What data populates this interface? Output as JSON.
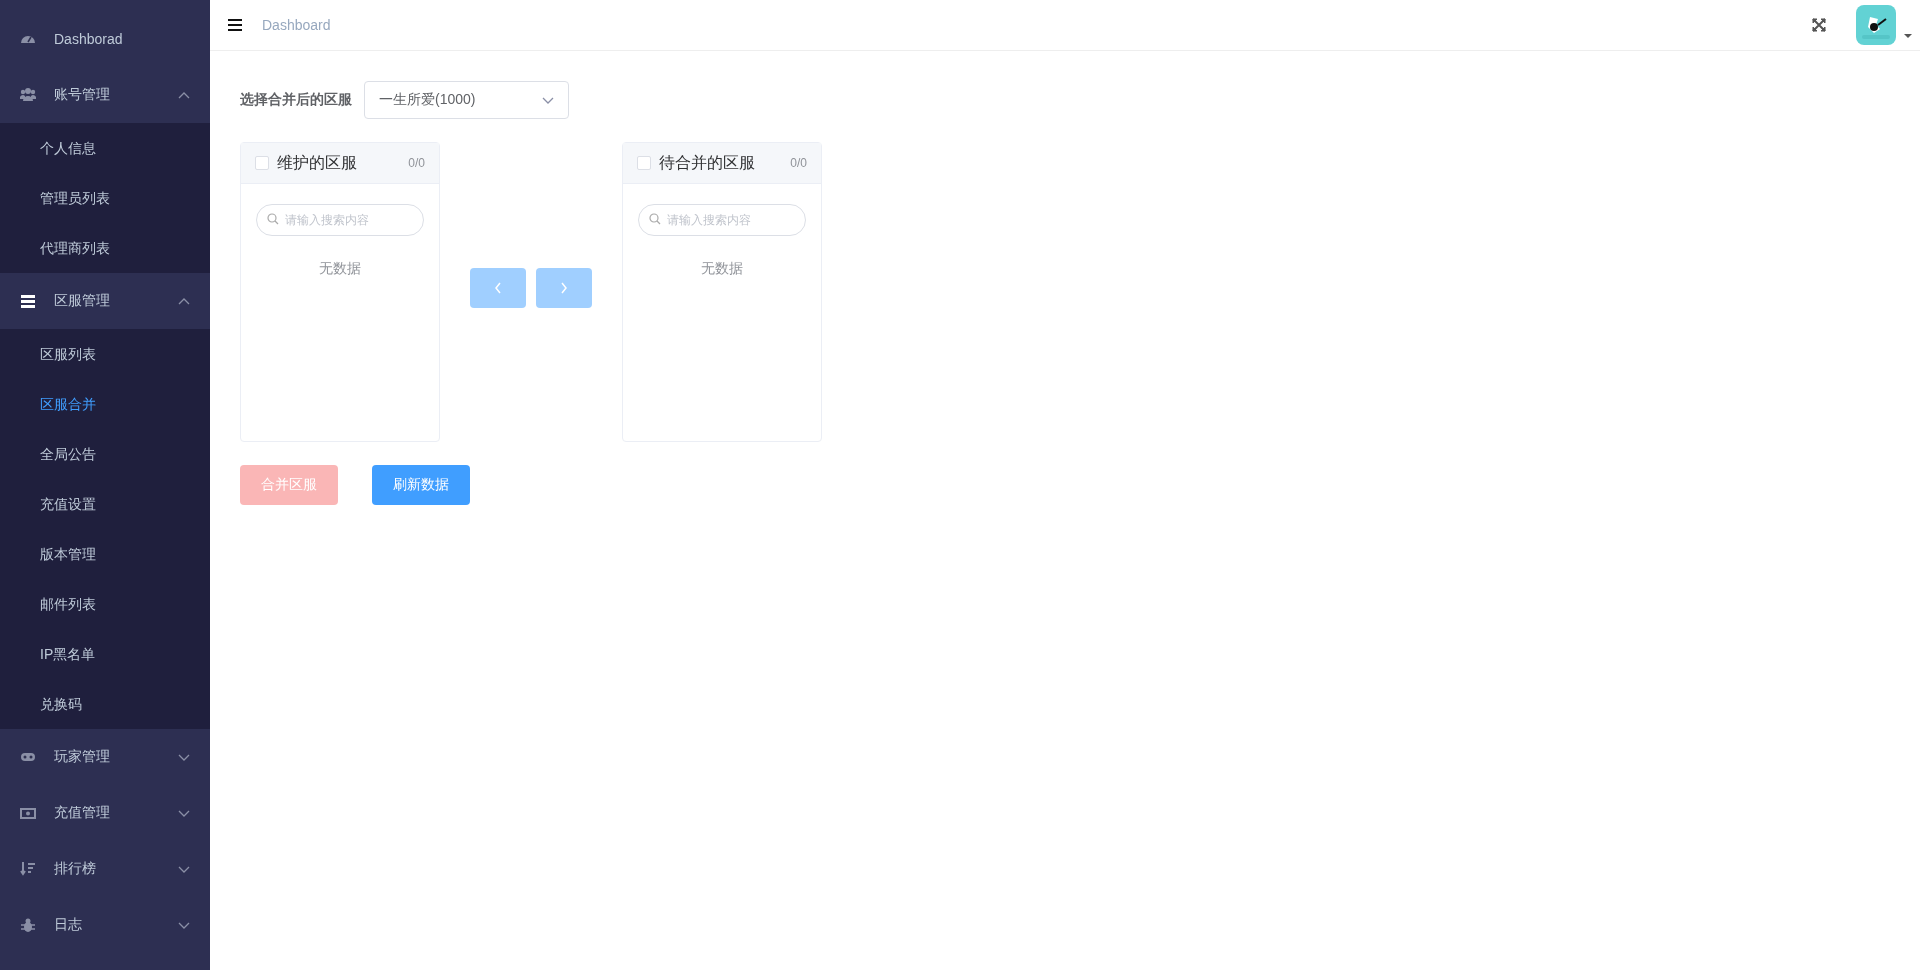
{
  "sidebar": {
    "items": [
      {
        "kind": "link",
        "label": "Dashborad",
        "selected": false
      },
      {
        "kind": "group",
        "label": "账号管理",
        "expanded": true,
        "children": [
          {
            "label": "个人信息",
            "selected": false
          },
          {
            "label": "管理员列表",
            "selected": false
          },
          {
            "label": "代理商列表",
            "selected": false
          }
        ]
      },
      {
        "kind": "group",
        "label": "区服管理",
        "expanded": true,
        "children": [
          {
            "label": "区服列表",
            "selected": false
          },
          {
            "label": "区服合并",
            "selected": true
          },
          {
            "label": "全局公告",
            "selected": false
          },
          {
            "label": "充值设置",
            "selected": false
          },
          {
            "label": "版本管理",
            "selected": false
          },
          {
            "label": "邮件列表",
            "selected": false
          },
          {
            "label": "IP黑名单",
            "selected": false
          },
          {
            "label": "兑换码",
            "selected": false
          }
        ]
      },
      {
        "kind": "group",
        "label": "玩家管理",
        "expanded": false
      },
      {
        "kind": "group",
        "label": "充值管理",
        "expanded": false
      },
      {
        "kind": "group",
        "label": "排行榜",
        "expanded": false
      },
      {
        "kind": "group",
        "label": "日志",
        "expanded": false
      }
    ]
  },
  "header": {
    "breadcrumb": "Dashboard"
  },
  "form": {
    "select_label": "选择合并后的区服",
    "select_value": "一生所爱(1000)"
  },
  "transfer": {
    "panels": [
      {
        "title": "维护的区服",
        "count": "0/0",
        "checked": false,
        "placeholder": "请输入搜索内容",
        "empty": "无数据"
      },
      {
        "title": "待合并的区服",
        "count": "0/0",
        "checked": false,
        "placeholder": "请输入搜索内容",
        "empty": "无数据"
      }
    ],
    "buttons": [
      {
        "disabled": true
      },
      {
        "disabled": true
      }
    ]
  },
  "actions": [
    {
      "label": "合并区服",
      "kind": "danger",
      "disabled": true
    },
    {
      "label": "刷新数据",
      "kind": "primary",
      "disabled": false
    }
  ]
}
